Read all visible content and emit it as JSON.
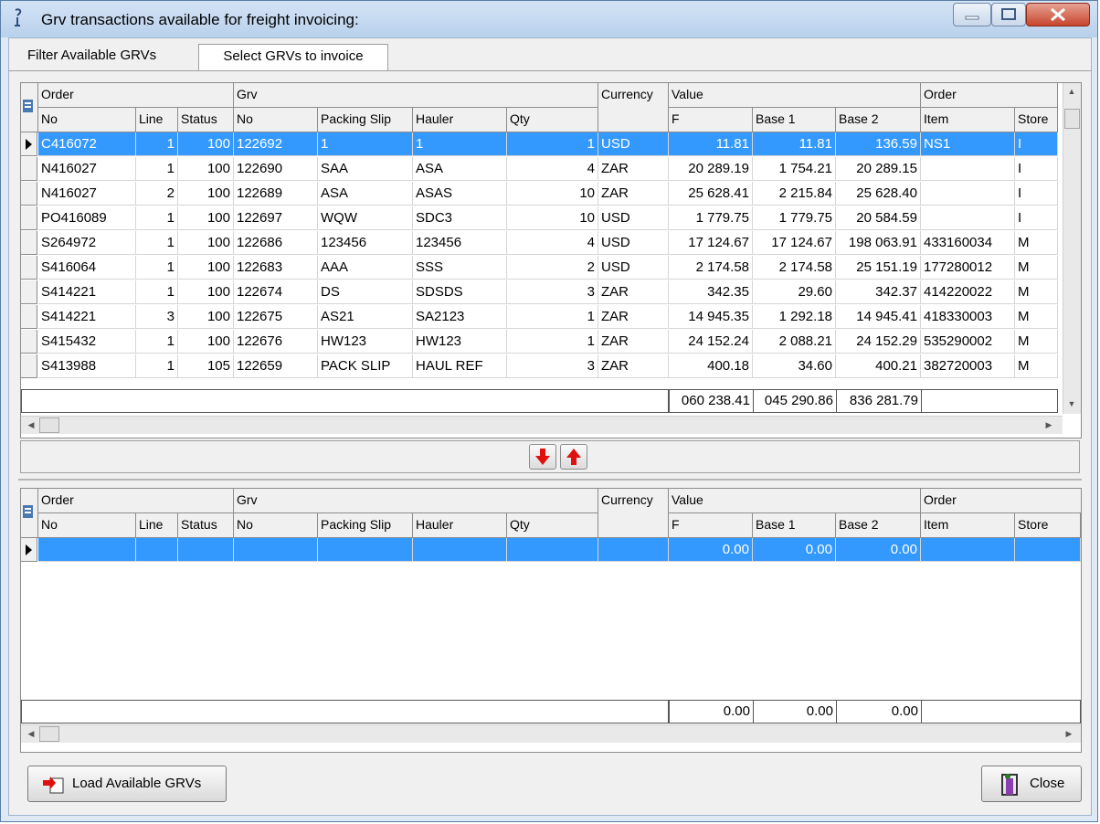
{
  "window": {
    "title": "Grv transactions available for freight invoicing:"
  },
  "tabs": [
    {
      "label": "Filter Available GRVs",
      "active": false
    },
    {
      "label": "Select GRVs to invoice",
      "active": true
    }
  ],
  "grid_headers": {
    "group_order": "Order",
    "group_grv": "Grv",
    "currency": "Currency",
    "group_value": "Value",
    "group_order2": "Order",
    "cols": [
      "No",
      "Line",
      "Status",
      "No",
      "Packing Slip",
      "Hauler",
      "Qty",
      "F",
      "Base 1",
      "Base 2",
      "Item",
      "Store"
    ]
  },
  "top_grid": {
    "rows": [
      [
        "C416072",
        "1",
        "100",
        "122692",
        "1",
        "1",
        "1",
        "USD",
        "11.81",
        "11.81",
        "136.59",
        "NS1",
        "I"
      ],
      [
        "N416027",
        "1",
        "100",
        "122690",
        "SAA",
        "ASA",
        "4",
        "ZAR",
        "20 289.19",
        "1 754.21",
        "20 289.15",
        "",
        "I"
      ],
      [
        "N416027",
        "2",
        "100",
        "122689",
        "ASA",
        "ASAS",
        "10",
        "ZAR",
        "25 628.41",
        "2 215.84",
        "25 628.40",
        "",
        "I"
      ],
      [
        "PO416089",
        "1",
        "100",
        "122697",
        "WQW",
        "SDC3",
        "10",
        "USD",
        "1 779.75",
        "1 779.75",
        "20 584.59",
        "",
        "I"
      ],
      [
        "S264972",
        "1",
        "100",
        "122686",
        "123456",
        "123456",
        "4",
        "USD",
        "17 124.67",
        "17 124.67",
        "198 063.91",
        "433160034",
        "M"
      ],
      [
        "S416064",
        "1",
        "100",
        "122683",
        "AAA",
        "SSS",
        "2",
        "USD",
        "2 174.58",
        "2 174.58",
        "25 151.19",
        "177280012",
        "M"
      ],
      [
        "S414221",
        "1",
        "100",
        "122674",
        "DS",
        "SDSDS",
        "3",
        "ZAR",
        "342.35",
        "29.60",
        "342.37",
        "414220022",
        "M"
      ],
      [
        "S414221",
        "3",
        "100",
        "122675",
        "AS21",
        "SA2123",
        "1",
        "ZAR",
        "14 945.35",
        "1 292.18",
        "14 945.41",
        "418330003",
        "M"
      ],
      [
        "S415432",
        "1",
        "100",
        "122676",
        "HW123",
        "HW123",
        "1",
        "ZAR",
        "24 152.24",
        "2 088.21",
        "24 152.29",
        "535290002",
        "M"
      ],
      [
        "S413988",
        "1",
        "105",
        "122659",
        "PACK SLIP",
        "HAUL REF",
        "3",
        "ZAR",
        "400.18",
        "34.60",
        "400.21",
        "382720003",
        "M"
      ]
    ],
    "totals": [
      "060 238.41",
      "045 290.86",
      "836 281.79"
    ]
  },
  "bottom_grid": {
    "row": [
      "",
      "",
      "",
      "",
      "",
      "",
      "",
      "",
      "0.00",
      "0.00",
      "0.00",
      "",
      ""
    ],
    "totals": [
      "0.00",
      "0.00",
      "0.00"
    ]
  },
  "buttons": {
    "load": "Load Available GRVs",
    "close": "Close"
  },
  "colors": {
    "selection": "#3399ff",
    "arrow_red": "#e01010"
  }
}
